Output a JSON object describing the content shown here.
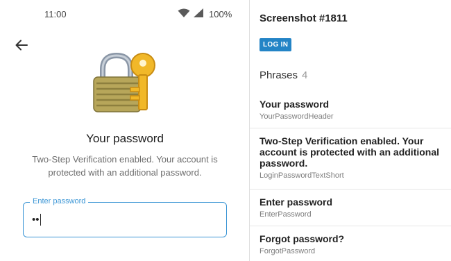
{
  "status_bar": {
    "time": "11:00",
    "battery": "100%",
    "icons": [
      "wifi-icon",
      "signal-icon"
    ]
  },
  "screen": {
    "title": "Your password",
    "subtitle": "Two-Step Verification enabled. Your account is protected with an additional password.",
    "password_field": {
      "label": "Enter password",
      "value": "••"
    }
  },
  "panel": {
    "title": "Screenshot #1811",
    "login_label": "LOG IN",
    "phrases_label": "Phrases",
    "phrases_count": "4",
    "phrases": [
      {
        "text": "Your password",
        "key": "YourPasswordHeader"
      },
      {
        "text": "Two-Step Verification enabled. Your account is protected with an additional password.",
        "key": "LoginPasswordTextShort"
      },
      {
        "text": "Enter password",
        "key": "EnterPassword"
      },
      {
        "text": "Forgot password?",
        "key": "ForgotPassword"
      }
    ]
  },
  "colors": {
    "accent": "#3a95d5",
    "login_button": "#2384c6"
  }
}
